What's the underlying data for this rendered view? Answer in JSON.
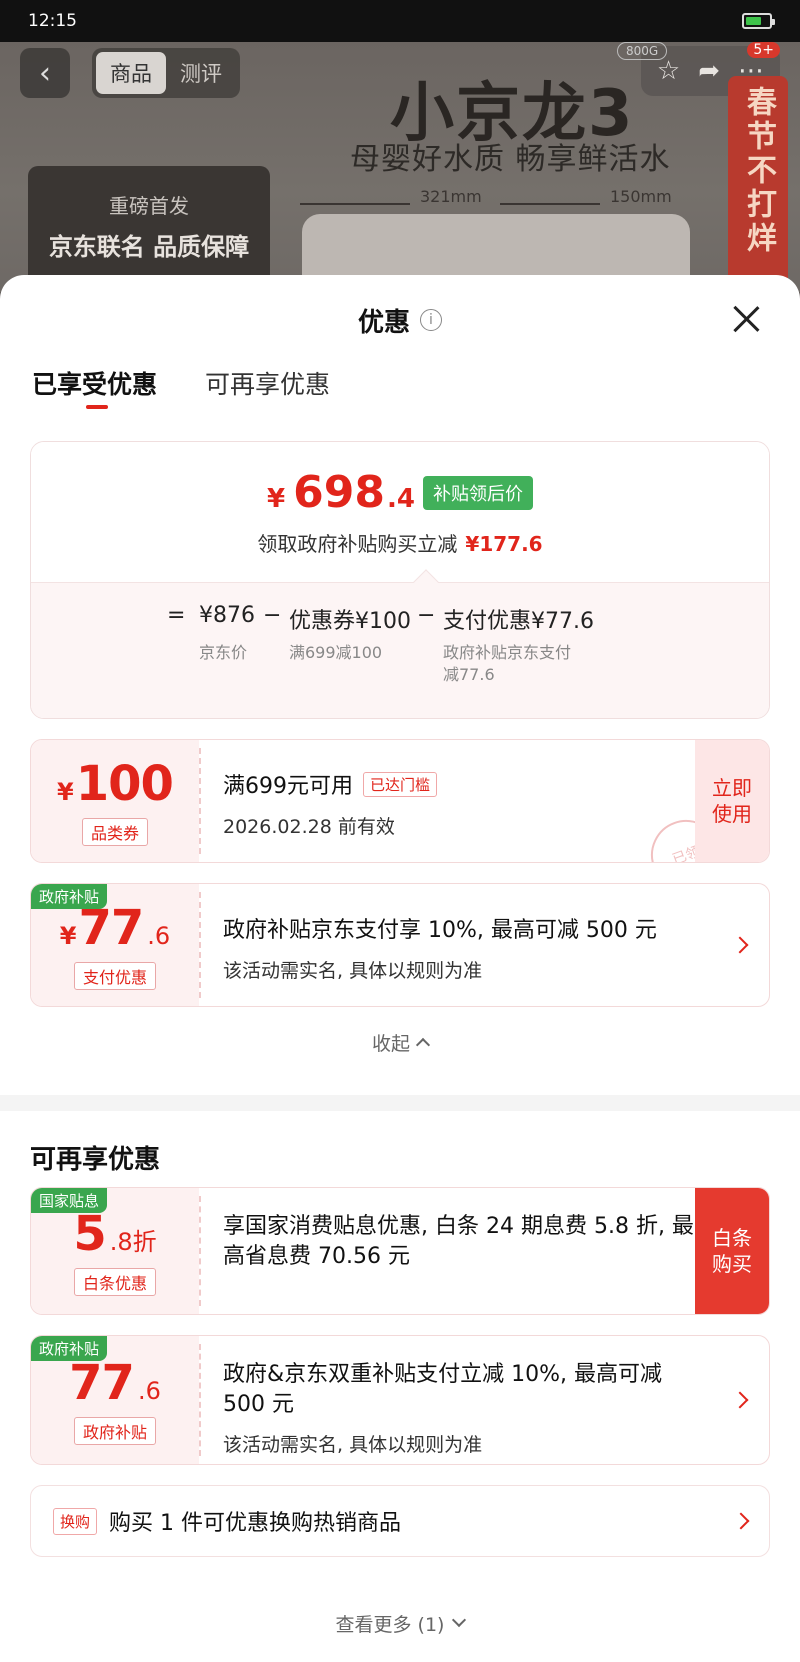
{
  "status_bar": {
    "time": "12:15"
  },
  "product_header": {
    "tabs": [
      "商品",
      "测评"
    ],
    "badge_800g": "800G",
    "badge_count": "5+",
    "title": "小京龙3",
    "subtitle": "母婴好水质 畅享鲜活水",
    "promo_line1": "重磅首发",
    "promo_line2": "京东联名 品质保障",
    "dim_width": "321mm",
    "dim_depth": "150mm",
    "side_banner": "春节不打烊"
  },
  "sheet": {
    "title": "优惠",
    "info_icon": "i",
    "tabs": [
      "已享受优惠",
      "可再享优惠"
    ]
  },
  "summary": {
    "yen": "¥",
    "price_int": "698",
    "price_dec": ".4",
    "tag": "补贴领后价",
    "desc": "领取政府补贴购买立减",
    "desc_amount": "¥177.6",
    "formula": {
      "eq": "=",
      "jd_price": "¥876",
      "jd_price_label": "京东价",
      "minus1": "−",
      "coupon": "优惠券¥100",
      "coupon_label": "满699减100",
      "minus2": "−",
      "pay": "支付优惠¥77.6",
      "pay_label_1": "政府补贴京东支付",
      "pay_label_2": "减77.6"
    }
  },
  "coupon1": {
    "yen": "¥",
    "amount": "100",
    "type": "品类券",
    "condition": "满699元可用",
    "chip": "已达门槛",
    "expiry": "2026.02.28 前有效",
    "action": "立即使用",
    "stamp": "已领"
  },
  "coupon2": {
    "corner": "政府补贴",
    "yen": "¥",
    "amount": "77",
    "decimal": ".6",
    "type": "支付优惠",
    "line1": "政府补贴京东支付享 10%, 最高可减 500 元",
    "line2": "该活动需实名, 具体以规则为准"
  },
  "collapse_label": "收起",
  "section2_title": "可再享优惠",
  "coupon3": {
    "corner": "国家贴息",
    "amount": "5",
    "decimal": ".8折",
    "type": "白条优惠",
    "line1": "享国家消费贴息优惠, 白条 24 期息费 5.8 折, 最高省息费 70.56 元",
    "action": "白条购买"
  },
  "coupon4": {
    "corner": "政府补贴",
    "amount": "77",
    "decimal": ".6",
    "type": "政府补贴",
    "line1": "政府&京东双重补贴支付立减 10%, 最高可减 500 元",
    "line2": "该活动需实名, 具体以规则为准"
  },
  "exchange": {
    "chip": "换购",
    "text": "购买 1 件可优惠换购热销商品"
  },
  "more_label": "查看更多 (1)"
}
